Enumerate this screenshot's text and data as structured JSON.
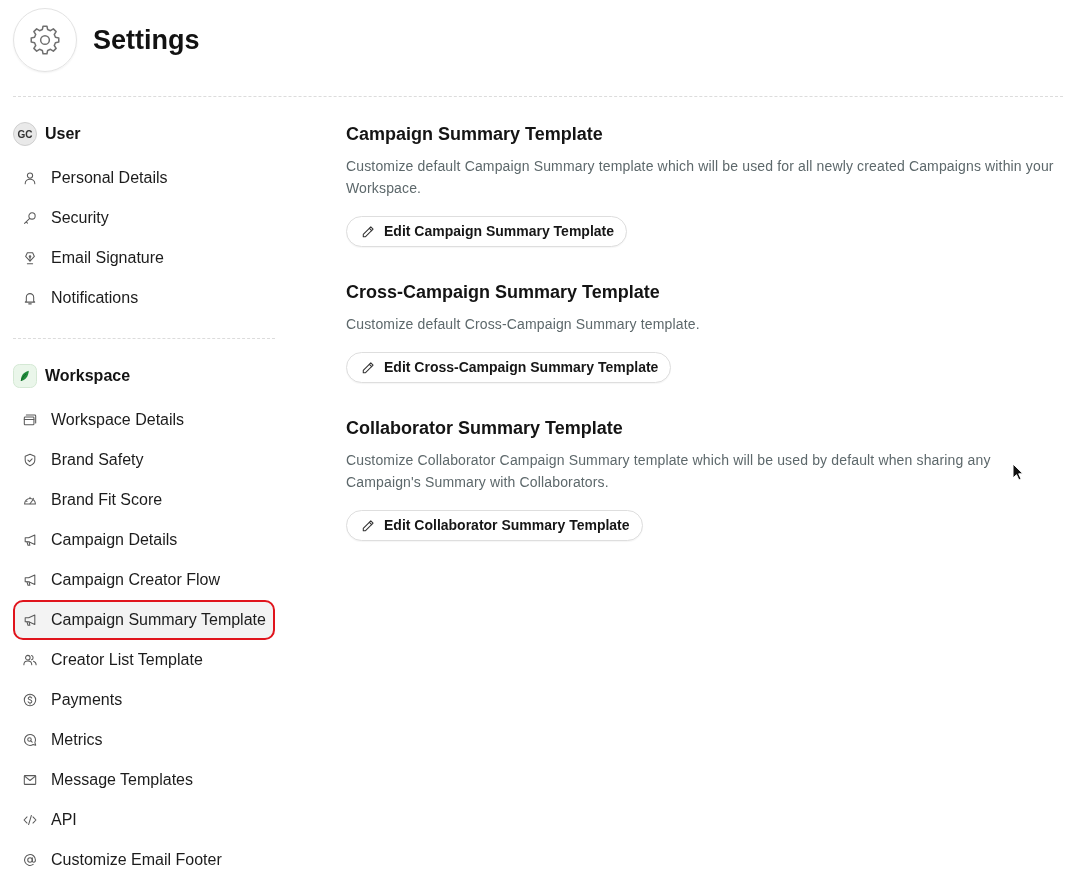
{
  "header": {
    "title": "Settings"
  },
  "sidebar": {
    "groups": [
      {
        "kind": "initials",
        "initials": "GC",
        "label": "User",
        "items": [
          {
            "label": "Personal Details",
            "kind": "person",
            "selected": false
          },
          {
            "label": "Security",
            "kind": "key",
            "selected": false
          },
          {
            "label": "Email Signature",
            "kind": "pen",
            "selected": false
          },
          {
            "label": "Notifications",
            "kind": "bell",
            "selected": false
          }
        ]
      },
      {
        "kind": "logo",
        "label": "Workspace",
        "items": [
          {
            "label": "Workspace Details",
            "kind": "window",
            "selected": false
          },
          {
            "label": "Brand Safety",
            "kind": "shield",
            "selected": false
          },
          {
            "label": "Brand Fit Score",
            "kind": "gauge",
            "selected": false
          },
          {
            "label": "Campaign Details",
            "kind": "megaphone",
            "selected": false
          },
          {
            "label": "Campaign Creator Flow",
            "kind": "megaphone",
            "selected": false
          },
          {
            "label": "Campaign Summary Template",
            "kind": "megaphone",
            "selected": true
          },
          {
            "label": "Creator List Template",
            "kind": "users",
            "selected": false
          },
          {
            "label": "Payments",
            "kind": "dollar",
            "selected": false
          },
          {
            "label": "Metrics",
            "kind": "metrics",
            "selected": false
          },
          {
            "label": "Message Templates",
            "kind": "envelope",
            "selected": false
          },
          {
            "label": "API",
            "kind": "code",
            "selected": false
          },
          {
            "label": "Customize Email Footer",
            "kind": "at",
            "selected": false
          }
        ]
      }
    ]
  },
  "sections": [
    {
      "title": "Campaign Summary Template",
      "description": "Customize default Campaign Summary template which will be used for all newly created Campaigns within your Workspace.",
      "button": "Edit Campaign Summary Template"
    },
    {
      "title": "Cross-Campaign Summary Template",
      "description": "Customize default Cross-Campaign Summary template.",
      "button": "Edit Cross-Campaign Summary Template"
    },
    {
      "title": "Collaborator Summary Template",
      "description": "Customize Collaborator Campaign Summary template which will be used by default when sharing any Campaign's Summary with Collaborators.",
      "button": "Edit Collaborator Summary Template"
    }
  ]
}
